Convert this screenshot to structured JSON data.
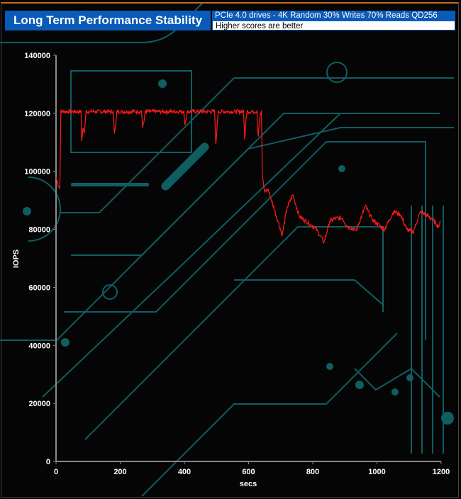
{
  "header": {
    "title": "Long Term Performance Stability",
    "subtitle": "PCIe 4.0 drives - 4K Random 30% Writes 70% Reads QD256",
    "note": "Higher scores are better"
  },
  "colors": {
    "line": "#ff1a1a",
    "title_bg": "#0a5ab8",
    "circuit": "#0f5e62"
  },
  "chart_data": {
    "type": "line",
    "title": "Long Term Performance Stability",
    "xlabel": "secs",
    "ylabel": "IOPS",
    "xlim": [
      0,
      1200
    ],
    "ylim": [
      0,
      140000
    ],
    "xticks": [
      0,
      200,
      400,
      600,
      800,
      1000,
      1200
    ],
    "yticks": [
      0,
      20000,
      40000,
      60000,
      80000,
      100000,
      120000,
      140000
    ],
    "grid": false,
    "series": [
      {
        "name": "IOPS",
        "points": [
          [
            0,
            98000
          ],
          [
            5,
            96000
          ],
          [
            12,
            94000
          ],
          [
            15,
            121000
          ],
          [
            78,
            121000
          ],
          [
            80,
            110400
          ],
          [
            84,
            115000
          ],
          [
            88,
            113000
          ],
          [
            91,
            117000
          ],
          [
            94,
            121000
          ],
          [
            178,
            121000
          ],
          [
            182,
            113000
          ],
          [
            186,
            116000
          ],
          [
            190,
            121000
          ],
          [
            266,
            121000
          ],
          [
            270,
            115000
          ],
          [
            274,
            117000
          ],
          [
            278,
            121000
          ],
          [
            398,
            121000
          ],
          [
            402,
            116000
          ],
          [
            406,
            118000
          ],
          [
            410,
            121000
          ],
          [
            494,
            121000
          ],
          [
            498,
            109500
          ],
          [
            502,
            116000
          ],
          [
            506,
            121000
          ],
          [
            584,
            121000
          ],
          [
            588,
            111000
          ],
          [
            592,
            118000
          ],
          [
            596,
            121000
          ],
          [
            626,
            121000
          ],
          [
            630,
            112000
          ],
          [
            634,
            118000
          ],
          [
            640,
            121000
          ],
          [
            643,
            98000
          ],
          [
            650,
            93000
          ],
          [
            661,
            93800
          ],
          [
            692,
            82600
          ],
          [
            705,
            78000
          ],
          [
            720,
            87500
          ],
          [
            738,
            91900
          ],
          [
            758,
            84500
          ],
          [
            809,
            80400
          ],
          [
            835,
            75500
          ],
          [
            853,
            82800
          ],
          [
            871,
            83800
          ],
          [
            893,
            83800
          ],
          [
            904,
            81400
          ],
          [
            935,
            79600
          ],
          [
            964,
            88000
          ],
          [
            986,
            83300
          ],
          [
            1023,
            79900
          ],
          [
            1052,
            86200
          ],
          [
            1074,
            85000
          ],
          [
            1092,
            80100
          ],
          [
            1112,
            78900
          ],
          [
            1136,
            86200
          ],
          [
            1169,
            83800
          ],
          [
            1193,
            80900
          ],
          [
            1197,
            83000
          ]
        ]
      }
    ]
  }
}
